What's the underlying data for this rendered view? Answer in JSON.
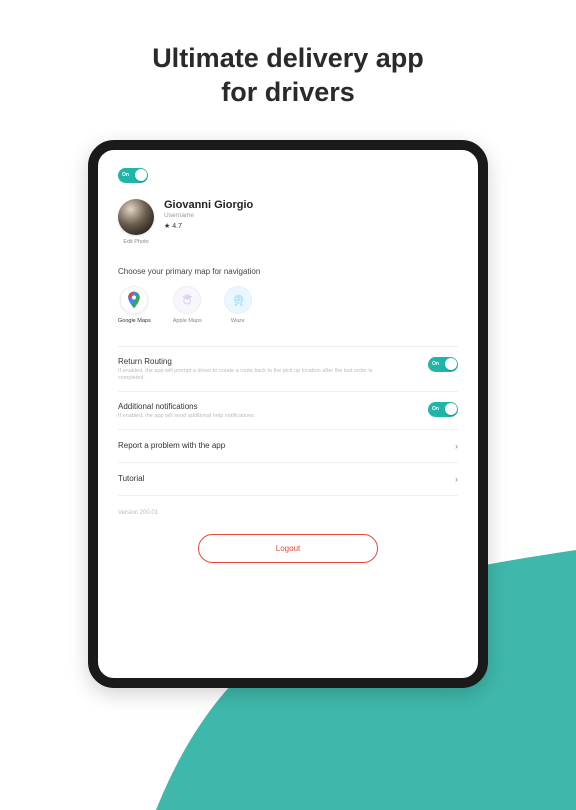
{
  "headline": {
    "line1": "Ultimate delivery app",
    "line2": "for drivers"
  },
  "toggleLabel": "On",
  "profile": {
    "name": "Giovanni Giorgio",
    "username": "Username",
    "ratingStar": "★",
    "ratingValue": "4.7",
    "editPhoto": "Edit Photo"
  },
  "mapSection": {
    "label": "Choose your primary map for navigation",
    "options": [
      {
        "label": "Google Maps"
      },
      {
        "label": "Apple Maps"
      },
      {
        "label": "Waze"
      }
    ]
  },
  "settings": {
    "returnRouting": {
      "title": "Return Routing",
      "desc": "If enabled, the app will prompt a driver to create a route back to the pick up location after the last order is completed."
    },
    "additionalNotifications": {
      "title": "Additional notifications",
      "desc": "If enabled, the app will send additional help notifications."
    }
  },
  "links": {
    "report": "Report a problem with the app",
    "tutorial": "Tutorial"
  },
  "version": "Version 200.01",
  "logout": "Logout"
}
